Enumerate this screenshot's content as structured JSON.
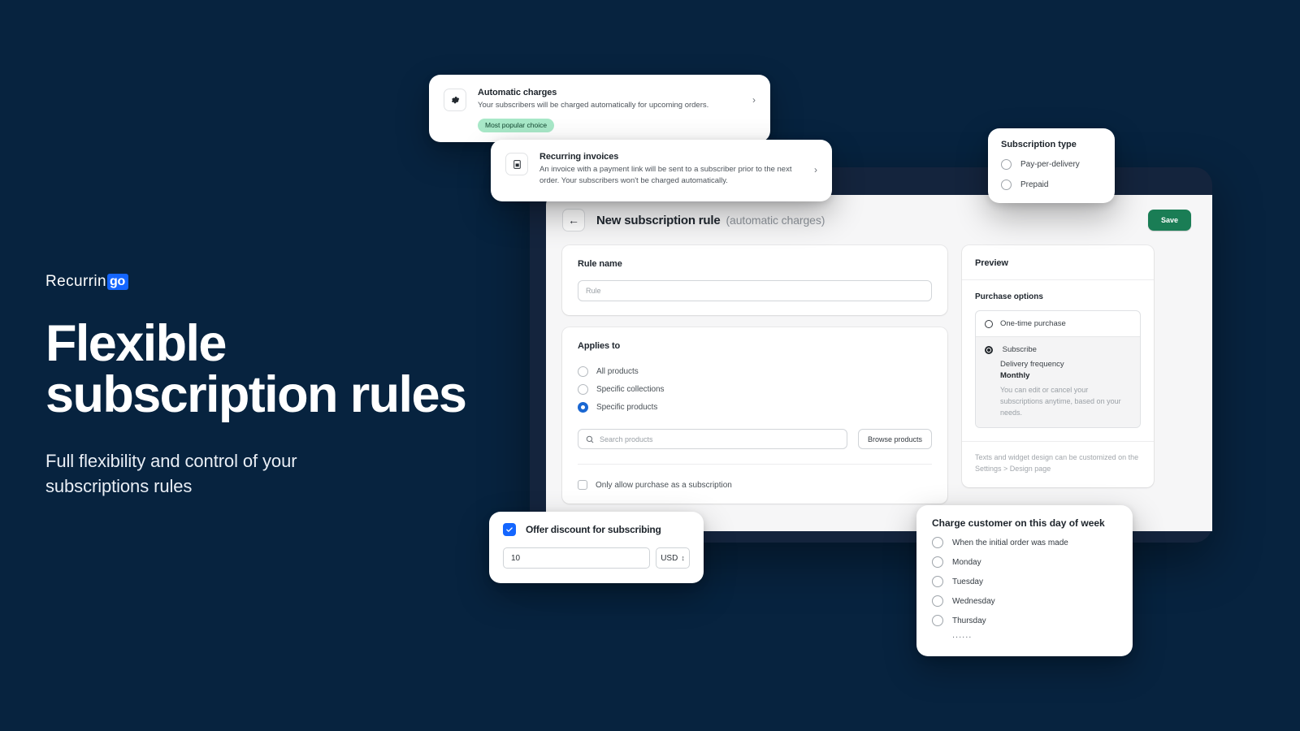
{
  "hero": {
    "logo_word": "Recurrin",
    "logo_badge": "go",
    "title": "Flexible\nsubscription rules",
    "subtitle": "Full flexibility and control of your\nsubscriptions rules"
  },
  "colors": {
    "background_dark": "#021b33",
    "background_edge": "#0b2c55",
    "accent_blue": "#1466ff",
    "radio_blue": "#1a67d2",
    "save_green": "#1a7d55",
    "badge_green": "#a8e8c8",
    "device_frame": "#14243d"
  },
  "charge_type_cards": [
    {
      "icon": "gear-icon",
      "title": "Automatic charges",
      "description": "Your subscribers will be charged automatically for upcoming orders.",
      "badge": "Most popular choice",
      "chevron": "›"
    },
    {
      "icon": "invoice-icon",
      "title": "Recurring invoices",
      "description": "An invoice with a payment link will be sent to a subscriber prior to the next order. Your subscribers won't be charged automatically.",
      "chevron": "›"
    }
  ],
  "subscription_type": {
    "title": "Subscription type",
    "options": [
      {
        "label": "Pay-per-delivery",
        "selected": false
      },
      {
        "label": "Prepaid",
        "selected": false
      }
    ]
  },
  "app": {
    "back_icon": "←",
    "title": "New subscription rule",
    "title_suffix": "(automatic charges)",
    "save_label": "Save",
    "rule_name": {
      "label": "Rule name",
      "value": "Rule"
    },
    "applies_to": {
      "label": "Applies to",
      "options": [
        {
          "label": "All products",
          "selected": false
        },
        {
          "label": "Specific collections",
          "selected": false
        },
        {
          "label": "Specific products",
          "selected": true
        }
      ],
      "search_placeholder": "Search products",
      "browse_label": "Browse products",
      "checkbox_label": "Only allow purchase as a subscription",
      "checkbox_checked": false
    },
    "preview": {
      "title": "Preview",
      "purchase_options_label": "Purchase options",
      "options": [
        {
          "label": "One-time purchase",
          "selected": false
        },
        {
          "label": "Subscribe",
          "selected": true
        }
      ],
      "delivery_frequency_label": "Delivery frequency",
      "delivery_frequency_value": "Monthly",
      "note": "You can edit or cancel your subscriptions anytime, based on your needs.",
      "footer": "Texts and widget design can be customized on the Settings > Design page"
    }
  },
  "discount": {
    "checkbox_label": "Offer discount for subscribing",
    "checked": true,
    "amount": "10",
    "currency": "USD"
  },
  "charge_day": {
    "title": "Charge customer on this day of week",
    "options": [
      {
        "label": "When the initial order was made",
        "selected": false
      },
      {
        "label": "Monday",
        "selected": false
      },
      {
        "label": "Tuesday",
        "selected": false
      },
      {
        "label": "Wednesday",
        "selected": false
      },
      {
        "label": "Thursday",
        "selected": false
      }
    ],
    "more_indicator": "......"
  }
}
